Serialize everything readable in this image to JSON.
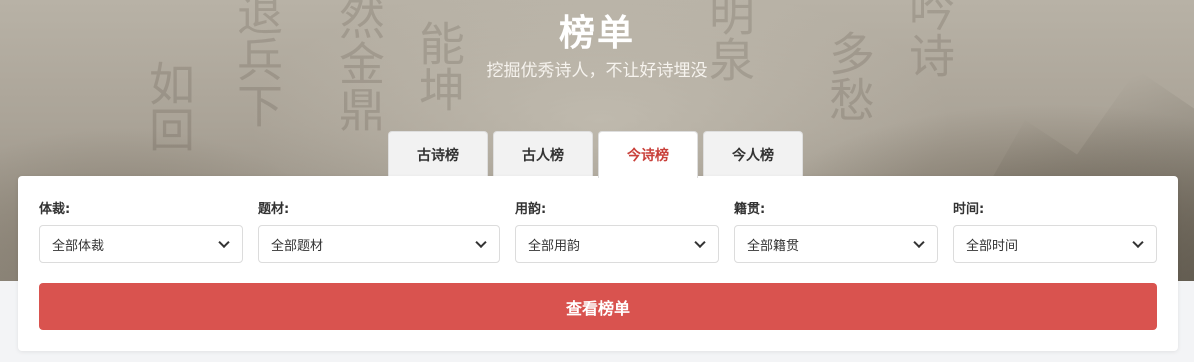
{
  "hero": {
    "title": "榜单",
    "subtitle": "挖掘优秀诗人，不让好诗埋没"
  },
  "tabs": [
    {
      "label": "古诗榜",
      "active": false
    },
    {
      "label": "古人榜",
      "active": false
    },
    {
      "label": "今诗榜",
      "active": true
    },
    {
      "label": "今人榜",
      "active": false
    }
  ],
  "filters": [
    {
      "label": "体裁:",
      "selected": "全部体裁"
    },
    {
      "label": "题材:",
      "selected": "全部题材"
    },
    {
      "label": "用韵:",
      "selected": "全部用韵"
    },
    {
      "label": "籍贯:",
      "selected": "全部籍贯"
    },
    {
      "label": "时间:",
      "selected": "全部时间"
    }
  ],
  "submit_label": "查看榜单",
  "colors": {
    "accent": "#d9534f",
    "active_tab_text": "#c9403a"
  }
}
